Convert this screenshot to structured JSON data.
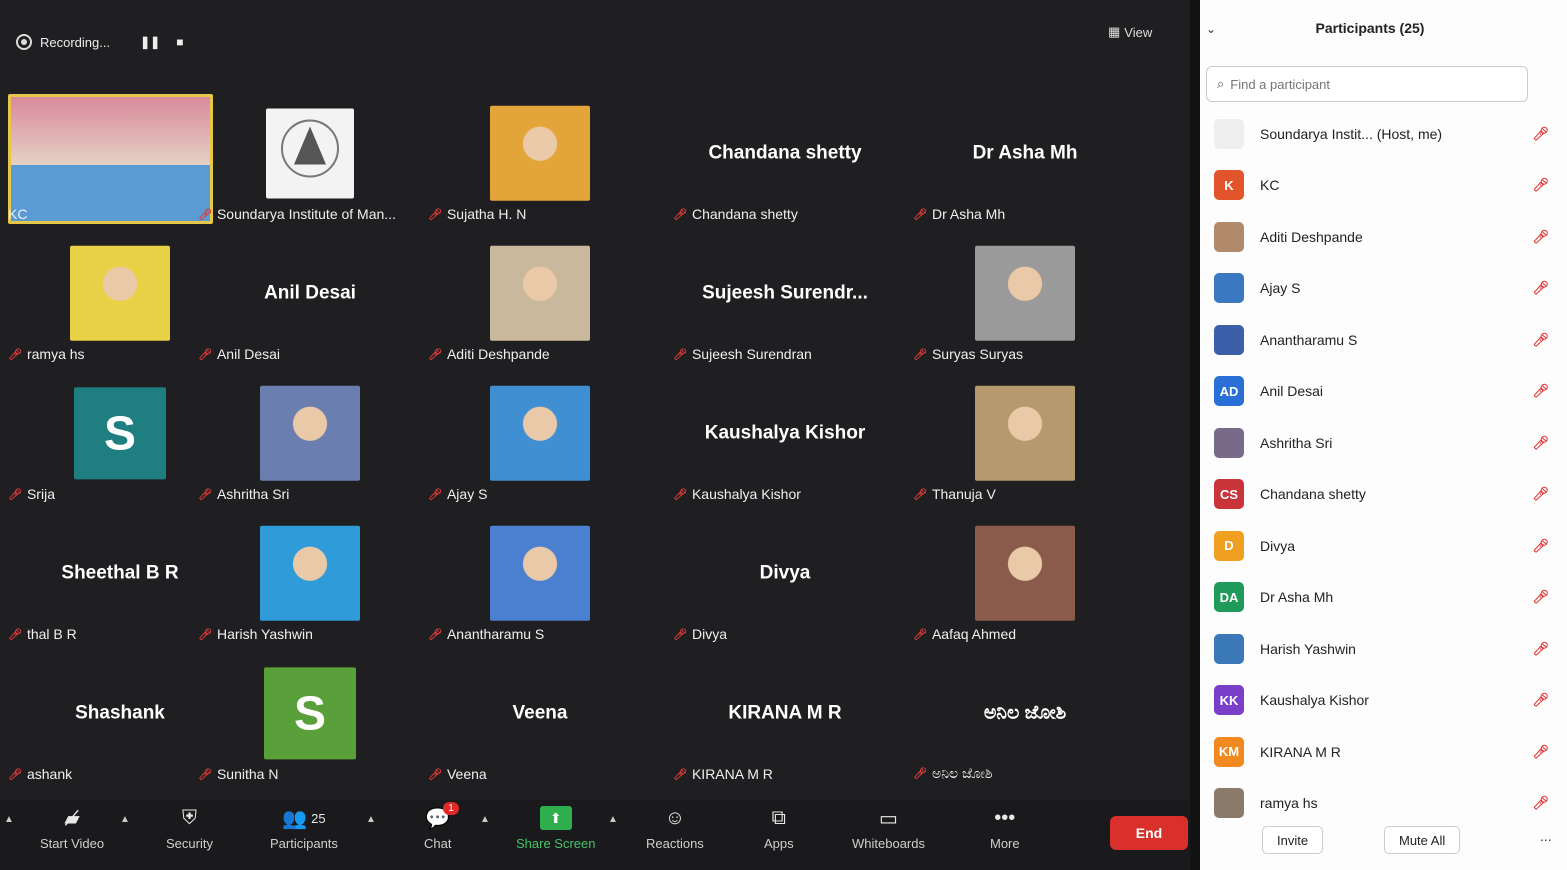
{
  "recording": {
    "label": "Recording...",
    "pause": "❚❚",
    "stop": "■"
  },
  "view": {
    "label": "View"
  },
  "tiles": [
    {
      "id": "kc",
      "label": "KC",
      "kind": "video",
      "color": "#5a9bd4",
      "active": true
    },
    {
      "id": "soundarya",
      "label": "Soundarya Institute of Man...",
      "kind": "logo",
      "color": "#f3f3f3"
    },
    {
      "id": "sujatha",
      "label": "Sujatha H. N",
      "kind": "image",
      "color": "#e3a53a"
    },
    {
      "id": "chandana",
      "label": "Chandana shetty",
      "bigname": "Chandana shetty",
      "kind": "name"
    },
    {
      "id": "asha",
      "label": "Dr Asha Mh",
      "bigname": "Dr Asha Mh",
      "kind": "name"
    },
    {
      "id": "ramya",
      "label": "ramya hs",
      "kind": "image",
      "color": "#e8d047"
    },
    {
      "id": "anil",
      "label": "Anil Desai",
      "bigname": "Anil Desai",
      "kind": "name"
    },
    {
      "id": "aditi",
      "label": "Aditi Deshpande",
      "kind": "image",
      "color": "#c9b89b"
    },
    {
      "id": "sujeesh",
      "label": "Sujeesh Surendran",
      "bigname": "Sujeesh Surendr...",
      "kind": "name"
    },
    {
      "id": "suryas",
      "label": "Suryas Suryas",
      "kind": "image",
      "color": "#9a9a9a"
    },
    {
      "id": "srija",
      "label": "Srija",
      "kind": "letter",
      "letter": "S",
      "color": "#1f7f80"
    },
    {
      "id": "ashritha",
      "label": "Ashritha Sri",
      "kind": "image",
      "color": "#6a7fb0"
    },
    {
      "id": "ajay",
      "label": "Ajay S",
      "kind": "image",
      "color": "#3f8fd2"
    },
    {
      "id": "kaushalya",
      "label": "Kaushalya Kishor",
      "bigname": "Kaushalya Kishor",
      "kind": "name"
    },
    {
      "id": "thanuja",
      "label": "Thanuja V",
      "kind": "image",
      "color": "#b49a6c"
    },
    {
      "id": "sheethal",
      "label": "thal B R",
      "bigname": "Sheethal B R",
      "kind": "name"
    },
    {
      "id": "harish",
      "label": "Harish Yashwin",
      "kind": "image",
      "color": "#2f9bd8"
    },
    {
      "id": "anantharamu",
      "label": "Anantharamu S",
      "kind": "image",
      "color": "#4b7fcf"
    },
    {
      "id": "divya",
      "label": "Divya",
      "bigname": "Divya",
      "kind": "name"
    },
    {
      "id": "aafaq",
      "label": "Aafaq Ahmed",
      "kind": "image",
      "color": "#8a5a4a"
    },
    {
      "id": "shashank",
      "label": "ashank",
      "bigname": "Shashank",
      "kind": "name"
    },
    {
      "id": "sunitha",
      "label": "Sunitha N",
      "kind": "letter",
      "letter": "S",
      "color": "#5aa03a"
    },
    {
      "id": "veena",
      "label": "Veena",
      "bigname": "Veena",
      "kind": "name"
    },
    {
      "id": "kirana",
      "label": "KIRANA M R",
      "bigname": "KIRANA M R",
      "kind": "name"
    },
    {
      "id": "kannada",
      "label": "ಅನಿಲ ಜೋಶಿ",
      "bigname": "ಅನಿಲ ಜೋಶಿ",
      "kind": "name"
    }
  ],
  "toolbar": {
    "start_video": "Start Video",
    "security": "Security",
    "participants": "Participants",
    "participants_count": "25",
    "chat": "Chat",
    "chat_badge": "1",
    "share_screen": "Share Screen",
    "reactions": "Reactions",
    "apps": "Apps",
    "whiteboards": "Whiteboards",
    "more": "More",
    "end": "End"
  },
  "panel": {
    "title": "Participants (25)",
    "search_placeholder": "Find a participant",
    "participants": [
      {
        "name": "Soundarya Instit... (Host, me)",
        "initials": "",
        "color": "#eeeeee",
        "text_color": "#555"
      },
      {
        "name": "KC",
        "initials": "K",
        "color": "#e2542a"
      },
      {
        "name": "Aditi Deshpande",
        "initials": "",
        "color": "#b08a6a"
      },
      {
        "name": "Ajay S",
        "initials": "",
        "color": "#3a78c2"
      },
      {
        "name": "Anantharamu S",
        "initials": "",
        "color": "#3b5fa8"
      },
      {
        "name": "Anil Desai",
        "initials": "AD",
        "color": "#2a6fd6"
      },
      {
        "name": "Ashritha Sri",
        "initials": "",
        "color": "#7a6a8a"
      },
      {
        "name": "Chandana shetty",
        "initials": "CS",
        "color": "#c8343a"
      },
      {
        "name": "Divya",
        "initials": "D",
        "color": "#f0a020"
      },
      {
        "name": "Dr Asha Mh",
        "initials": "DA",
        "color": "#1f9a5a"
      },
      {
        "name": "Harish Yashwin",
        "initials": "",
        "color": "#3a78b8"
      },
      {
        "name": "Kaushalya Kishor",
        "initials": "KK",
        "color": "#7a3fc8"
      },
      {
        "name": "KIRANA M R",
        "initials": "KM",
        "color": "#f08a20"
      },
      {
        "name": "ramya hs",
        "initials": "",
        "color": "#8a7a6a"
      }
    ],
    "invite": "Invite",
    "mute_all": "Mute All",
    "more": "..."
  }
}
